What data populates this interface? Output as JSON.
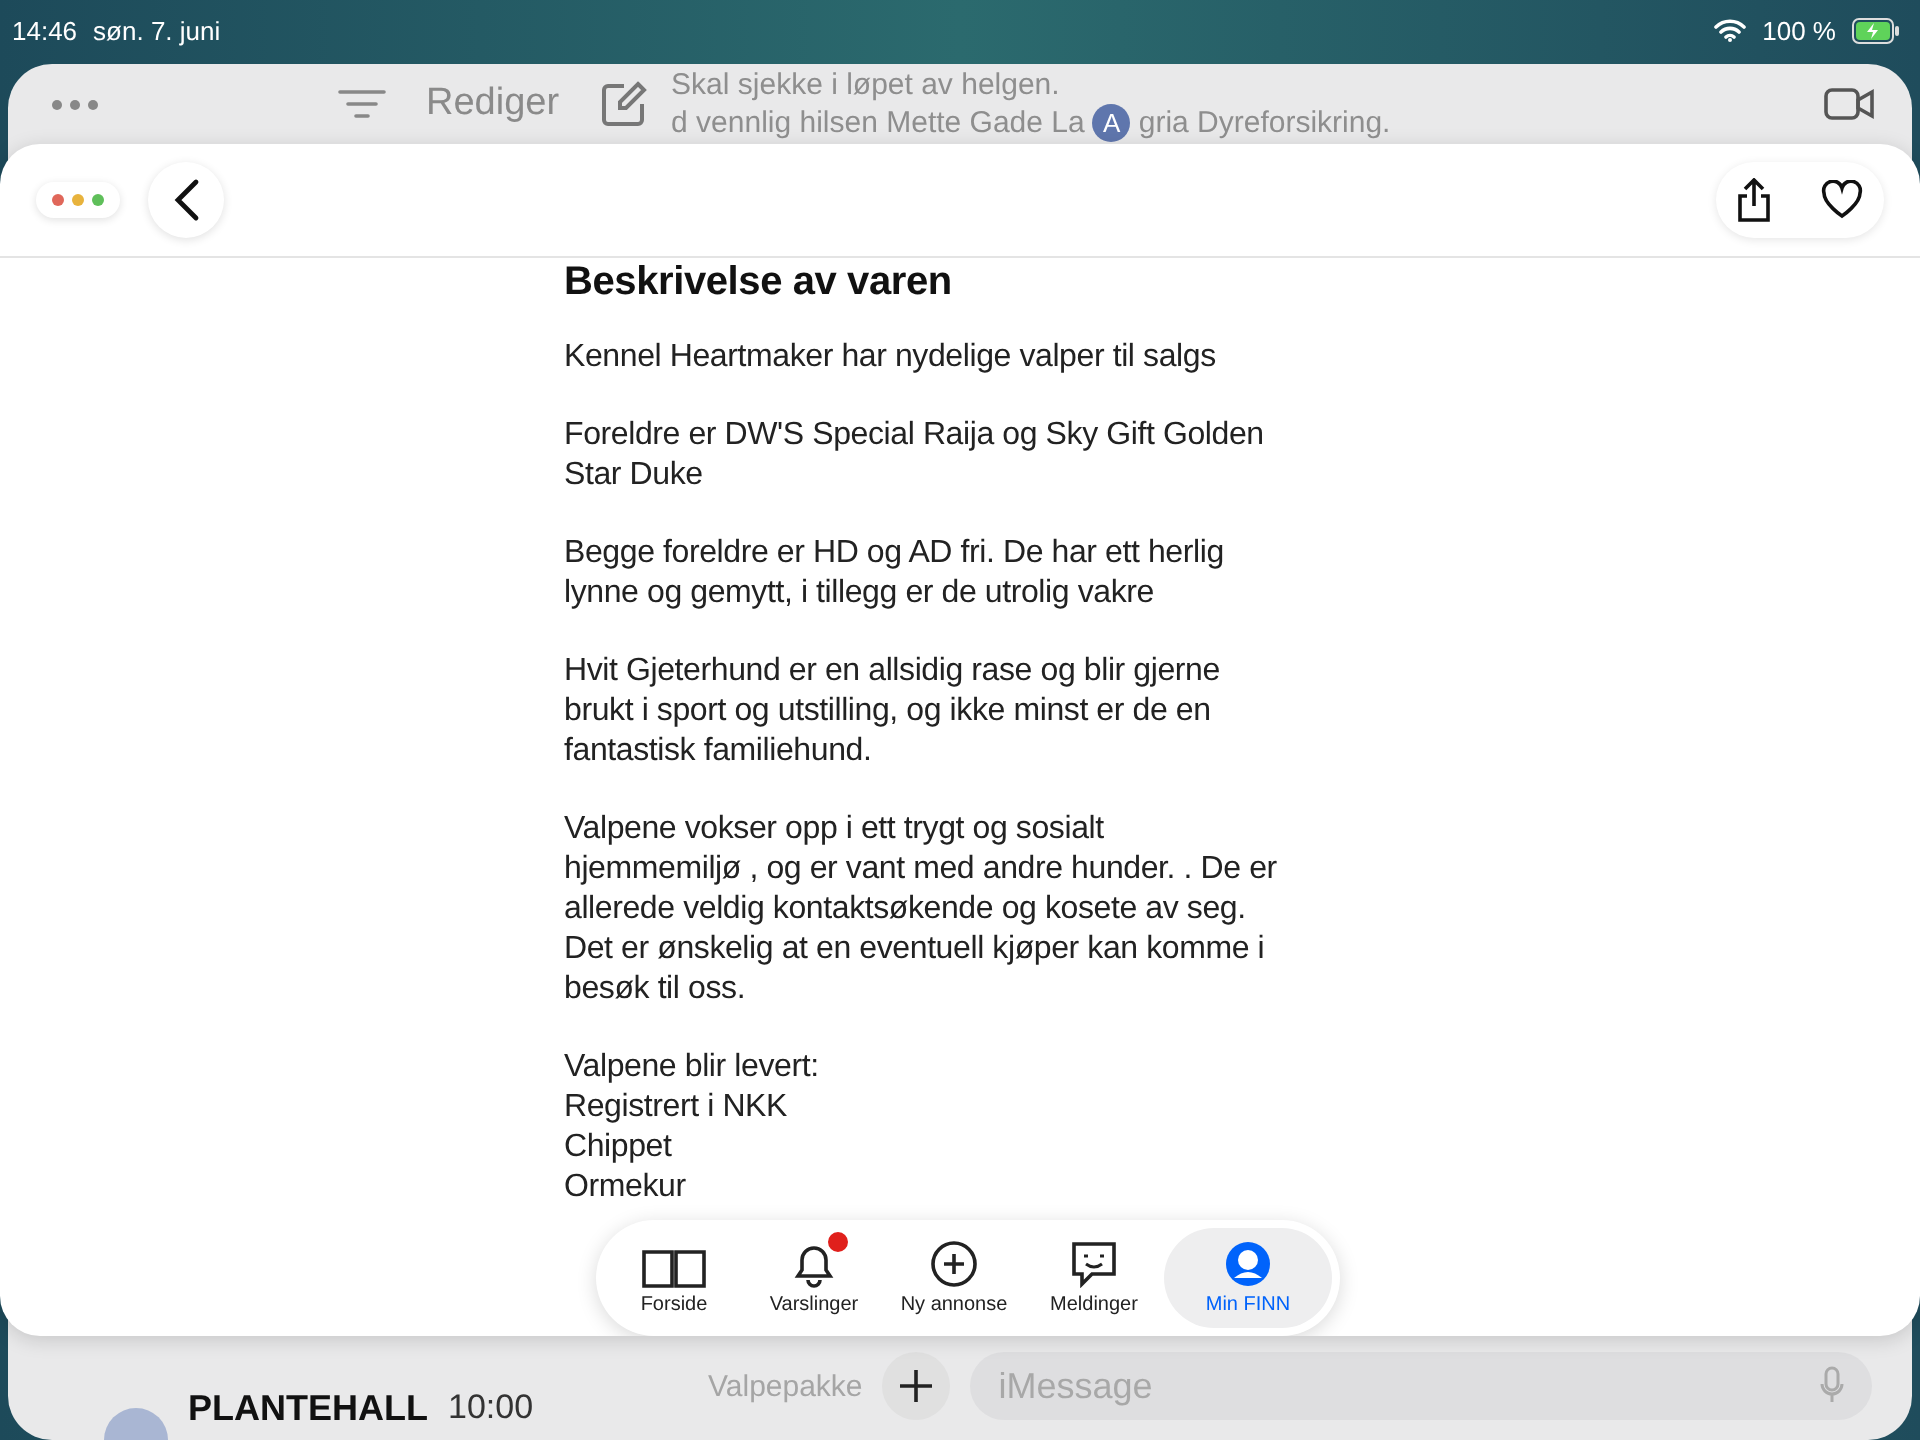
{
  "status_bar": {
    "time": "14:46",
    "date": "søn. 7. juni",
    "battery": "100 %"
  },
  "background_app": {
    "edit": "Rediger",
    "preview_lines": [
      "Skal sjekke i løpet av helgen.",
      "d vennlig hilsen Mette Gade La",
      "gria Dyreforsikring."
    ],
    "avatar": "A",
    "message_field": {
      "placeholder": "iMessage"
    },
    "faded_line": "Valpepakke",
    "conversation": {
      "name": "PLANTEHALL",
      "time": "10:00"
    }
  },
  "window_dots": [
    {
      "color": "#e0675a"
    },
    {
      "color": "#e8b33d"
    },
    {
      "color": "#5fbf5a"
    }
  ],
  "description": {
    "heading": "Beskrivelse av varen",
    "paragraphs": [
      "Kennel Heartmaker har nydelige valper til salgs",
      "Foreldre er DW'S Special Raija og Sky Gift Golden Star Duke",
      "Begge foreldre er HD og AD fri. De har ett herlig lynne og gemytt, i tillegg er de utrolig vakre",
      "Hvit Gjeterhund er en allsidig rase og blir gjerne brukt i sport og utstilling, og ikke minst er de en fantastisk familiehund.",
      "Valpene vokser opp i ett trygt og sosialt hjemmemiljø , og er vant med andre hunder. . De er allerede veldig kontaktsøkende og kosete av seg. Det er ønskelig at en eventuell kjøper kan komme i besøk til oss."
    ],
    "list_title": "Valpene blir levert:",
    "list": [
      "Registrert i NKK",
      "Chippet",
      "Ormekur"
    ]
  },
  "tabs": [
    {
      "label": "Forside",
      "kind": "book",
      "selected": false,
      "badge": false
    },
    {
      "label": "Varslinger",
      "kind": "bell",
      "selected": false,
      "badge": true
    },
    {
      "label": "Ny annonse",
      "kind": "plus",
      "selected": false,
      "badge": false
    },
    {
      "label": "Meldinger",
      "kind": "chat",
      "selected": false,
      "badge": false
    },
    {
      "label": "Min FINN",
      "kind": "profile",
      "selected": true,
      "badge": false
    }
  ]
}
